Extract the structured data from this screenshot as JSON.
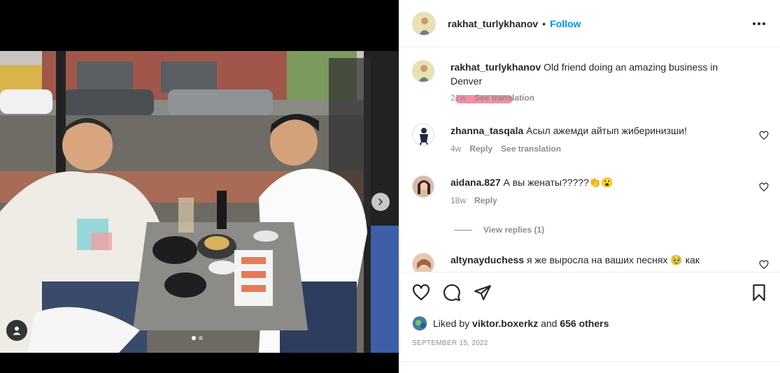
{
  "post": {
    "author": "rakhat_turlykhanov",
    "separator": "•",
    "follow_label": "Follow",
    "caption": {
      "text_line1": "Old friend doing an amazing business in",
      "text_line2": "Denver",
      "time": "21w",
      "see_translation": "See translation"
    }
  },
  "comments": [
    {
      "username": "zhanna_tasqala",
      "text": "Асыл ажемди айтып жиберинизши!",
      "time": "4w",
      "reply_label": "Reply",
      "translation_label": "See translation"
    },
    {
      "username": "aidana.827",
      "text": "А вы женаты?????👏😮",
      "time": "18w",
      "reply_label": "Reply"
    },
    {
      "username": "altynayduchess",
      "text": "я же выросла на ваших песнях 🥹 как"
    }
  ],
  "view_replies_label": "View replies (1)",
  "likes": {
    "prefix": "Liked by",
    "user": "viktor.boxerkz",
    "connector": "and",
    "others": "656 others"
  },
  "date": "SEPTEMBER 15, 2022",
  "icons": {
    "like": "heart-icon",
    "comment": "comment-icon",
    "share": "paper-plane-icon",
    "save": "bookmark-icon",
    "more": "more-horizontal-icon",
    "next": "chevron-right-icon",
    "tags": "person-icon"
  },
  "colors": {
    "accent": "#0095f6",
    "text": "#262626",
    "muted": "#8e8e8e"
  }
}
